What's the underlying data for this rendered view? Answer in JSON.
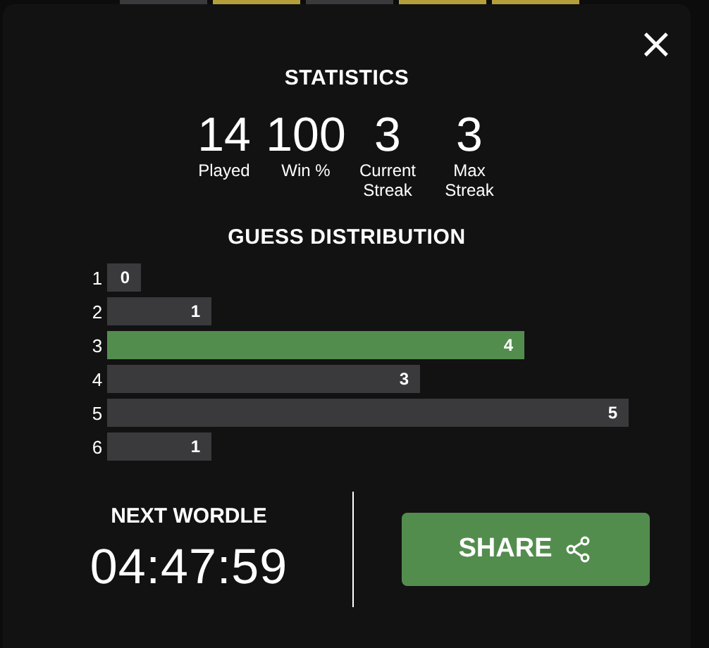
{
  "background_tiles": [
    {
      "color": "#3a3a3c"
    },
    {
      "color": "#b59f3b"
    },
    {
      "color": "#3a3a3c"
    },
    {
      "color": "#b59f3b"
    },
    {
      "color": "#b59f3b"
    }
  ],
  "modal": {
    "close": "×",
    "title": "STATISTICS",
    "stats": [
      {
        "value": "14",
        "label": "Played"
      },
      {
        "value": "100",
        "label": "Win %"
      },
      {
        "value": "3",
        "label": "Current Streak"
      },
      {
        "value": "3",
        "label": "Max Streak"
      }
    ],
    "distribution_title": "GUESS DISTRIBUTION",
    "distribution": [
      {
        "guess": "1",
        "count": "0",
        "selected": false
      },
      {
        "guess": "2",
        "count": "1",
        "selected": false
      },
      {
        "guess": "3",
        "count": "4",
        "selected": true
      },
      {
        "guess": "4",
        "count": "3",
        "selected": false
      },
      {
        "guess": "5",
        "count": "5",
        "selected": false
      },
      {
        "guess": "6",
        "count": "1",
        "selected": false
      }
    ],
    "next_label": "NEXT WORDLE",
    "countdown": "04:47:59",
    "share": "SHARE"
  }
}
